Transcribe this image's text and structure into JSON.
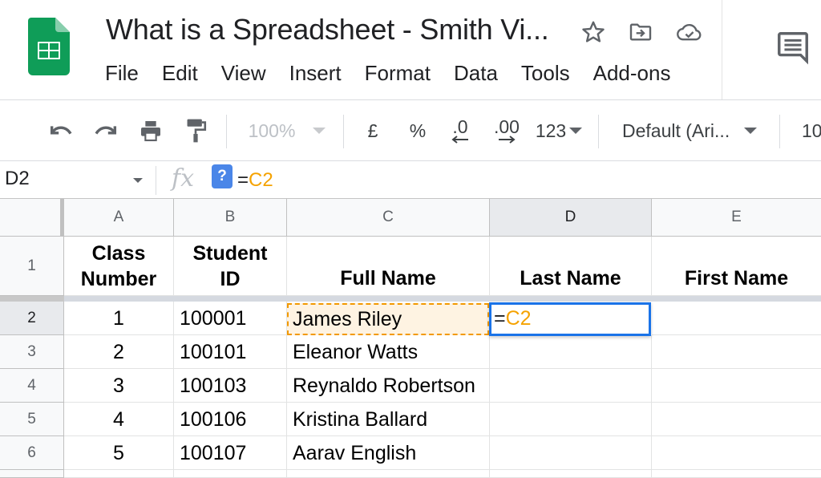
{
  "document": {
    "title": "What is a Spreadsheet - Smith Vi..."
  },
  "menu": [
    "File",
    "Edit",
    "View",
    "Insert",
    "Format",
    "Data",
    "Tools",
    "Add-ons"
  ],
  "toolbar": {
    "zoom": "100%",
    "currency": "£",
    "percent": "%",
    "decrease_decimal": ".0",
    "increase_decimal": ".00",
    "more_formats": "123",
    "font": "Default (Ari...",
    "font_size_partial": "10"
  },
  "formula_bar": {
    "name_box": "D2",
    "fx": "fx",
    "help": "?",
    "equals": "=",
    "ref": "C2"
  },
  "columns": [
    "A",
    "B",
    "C",
    "D",
    "E"
  ],
  "rows": [
    "1",
    "2",
    "3",
    "4",
    "5",
    "6"
  ],
  "header_row": {
    "A": [
      "Class",
      "Number"
    ],
    "B": [
      "Student",
      "ID"
    ],
    "C": "Full Name",
    "D": "Last Name",
    "E": "First Name"
  },
  "data_rows": [
    {
      "A": "1",
      "B": "100001",
      "C": "James Riley",
      "D": "",
      "E": ""
    },
    {
      "A": "2",
      "B": "100101",
      "C": "Eleanor Watts",
      "D": "",
      "E": ""
    },
    {
      "A": "3",
      "B": "100103",
      "C": "Reynaldo Robertson",
      "D": "",
      "E": ""
    },
    {
      "A": "4",
      "B": "100106",
      "C": "Kristina Ballard",
      "D": "",
      "E": ""
    },
    {
      "A": "5",
      "B": "100107",
      "C": "Aarav English",
      "D": "",
      "E": ""
    }
  ],
  "active_cell": {
    "equals": "=",
    "ref": "C2"
  },
  "colors": {
    "sheets_green": "#0f9d58",
    "selection_blue": "#1a73e8",
    "reference_orange": "#f29900"
  },
  "icons": {
    "star": "star-icon",
    "move": "move-to-folder-icon",
    "cloud": "cloud-saved-icon",
    "comment": "comment-icon"
  }
}
